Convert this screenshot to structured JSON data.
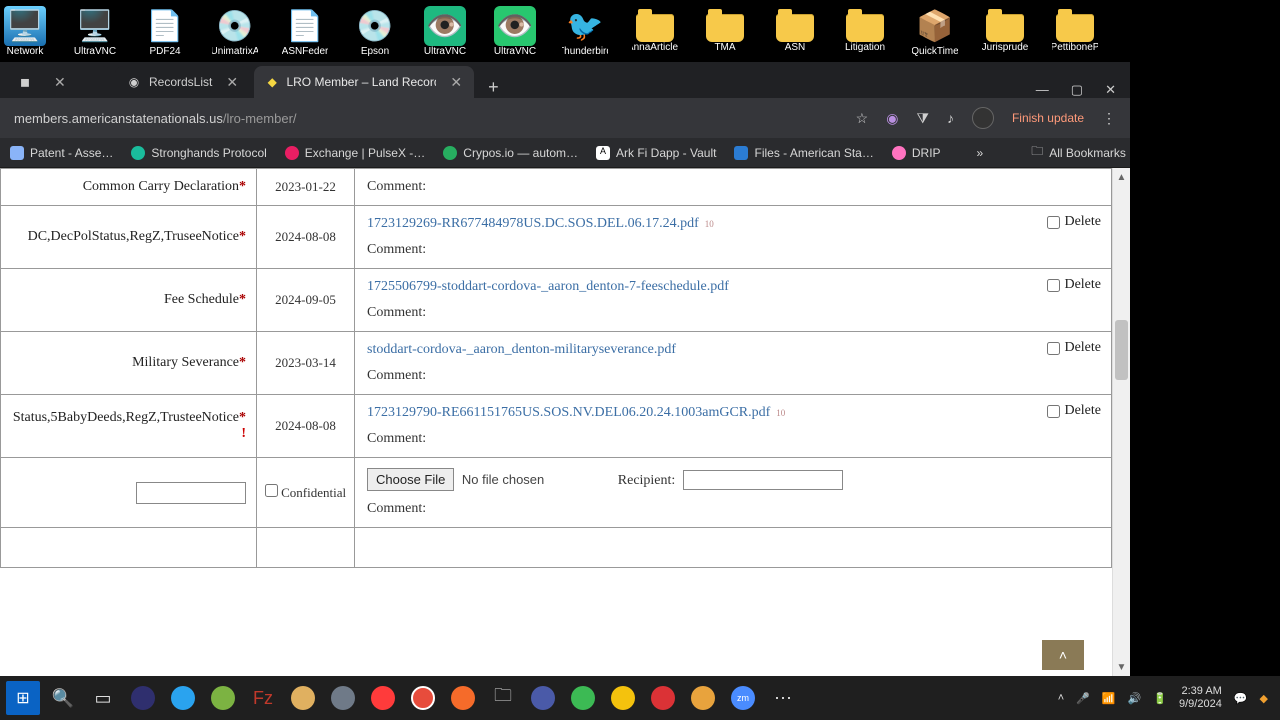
{
  "desktop": {
    "icons": [
      "Network",
      "UltraVNC",
      "PDF24",
      "UnimatrixA",
      "ASNFeder",
      "Epson",
      "UltraVNC",
      "UltraVNC",
      "Thunderbird",
      "AnnaArticles",
      "TMA",
      "ASN",
      "Litigation",
      "QuickTime",
      "Jurisprude",
      "PettiboneP"
    ]
  },
  "browser": {
    "tabs": [
      {
        "label": "",
        "active": false
      },
      {
        "label": "RecordsList",
        "active": false
      },
      {
        "label": "LRO Member – Land Recording",
        "active": true
      }
    ],
    "url_host": "members.americanstatenationals.us",
    "url_path": "/lro-member/",
    "finish_update": "Finish update",
    "bookmarks": [
      "Patent - Asse…",
      "Stronghands Protocol",
      "Exchange | PulseX -…",
      "Crypos.io — autom…",
      "Ark Fi Dapp - Vault",
      "Files - American Sta…",
      "DRIP"
    ],
    "all_bookmarks": "All Bookmarks"
  },
  "rows": [
    {
      "title": "Common Carry Declaration",
      "ast": "*",
      "date": "2023-01-22",
      "link": "",
      "comment": "Comment:",
      "show_delete": false,
      "truncated_top": true
    },
    {
      "title": "DC,DecPolStatus,RegZ,TruseeNotice",
      "ast": "*",
      "date": "2024-08-08",
      "link": "1723129269-RR677484978US.DC.SOS.DEL.06.17.24.pdf",
      "badge": "10",
      "comment": "Comment:",
      "show_delete": true
    },
    {
      "title": "Fee Schedule",
      "ast": "*",
      "date": "2024-09-05",
      "link": "1725506799-stoddart-cordova-_aaron_denton-7-feeschedule.pdf",
      "comment": "Comment:",
      "show_delete": true
    },
    {
      "title": "Military Severance",
      "ast": "*",
      "date": "2023-03-14",
      "link": "stoddart-cordova-_aaron_denton-militaryseverance.pdf",
      "comment": "Comment:",
      "show_delete": true
    },
    {
      "title": "Status,5BabyDeeds,RegZ,TrusteeNotice",
      "ast": "*",
      "exc": " !",
      "date": "2024-08-08",
      "link": "1723129790-RE661151765US.SOS.NV.DEL06.20.24.1003amGCR.pdf",
      "badge": "10",
      "comment": "Comment:",
      "show_delete": true
    }
  ],
  "upload": {
    "confidential": "Confidential",
    "choose": "Choose File",
    "nofile": "No file chosen",
    "recipient": "Recipient:",
    "comment": "Comment:"
  },
  "labels": {
    "delete": "Delete"
  },
  "tray": {
    "time": "2:39 AM",
    "date": "9/9/2024"
  }
}
